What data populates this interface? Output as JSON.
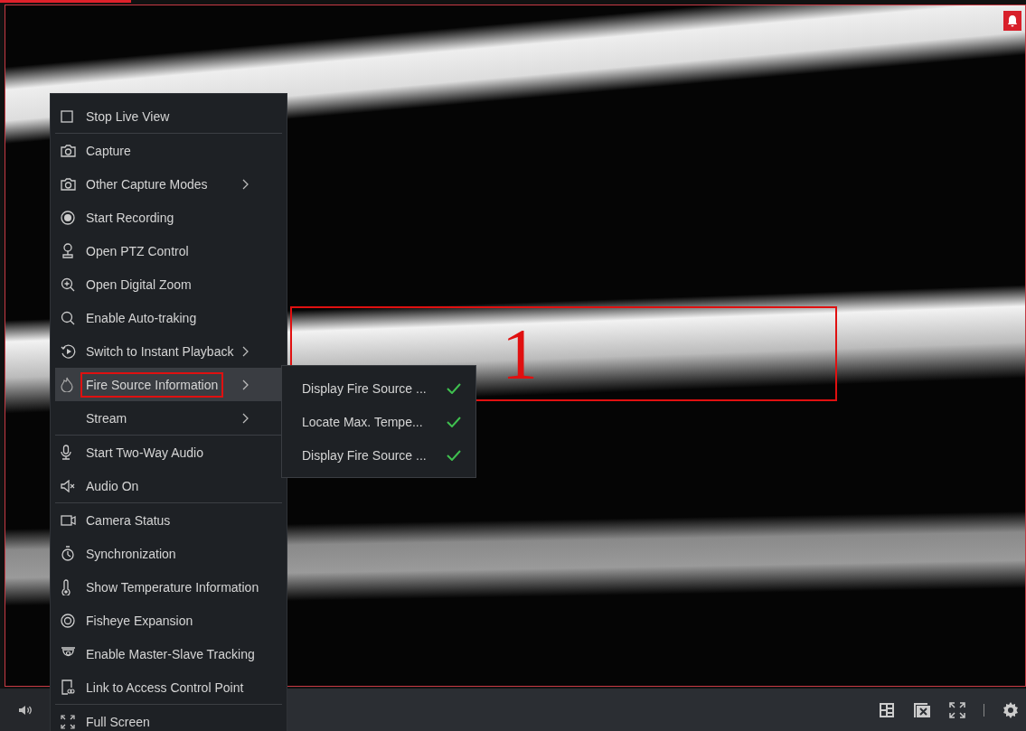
{
  "context_menu": {
    "groups": [
      [
        {
          "label": "Stop Live View",
          "submenu": false,
          "selected": false,
          "highlighted": false
        }
      ],
      [
        {
          "label": "Capture",
          "submenu": false,
          "selected": false,
          "highlighted": false
        },
        {
          "label": "Other Capture Modes",
          "submenu": true,
          "selected": false,
          "highlighted": false
        },
        {
          "label": "Start Recording",
          "submenu": false,
          "selected": false,
          "highlighted": false
        },
        {
          "label": "Open PTZ Control",
          "submenu": false,
          "selected": false,
          "highlighted": false
        },
        {
          "label": "Open Digital Zoom",
          "submenu": false,
          "selected": false,
          "highlighted": false
        },
        {
          "label": "Enable Auto-traking",
          "submenu": false,
          "selected": false,
          "highlighted": false
        },
        {
          "label": "Switch to Instant Playback",
          "submenu": true,
          "selected": false,
          "highlighted": false
        },
        {
          "label": "Fire Source Information",
          "submenu": true,
          "selected": true,
          "highlighted": true
        },
        {
          "label": "Stream",
          "submenu": true,
          "selected": false,
          "highlighted": false
        }
      ],
      [
        {
          "label": "Start Two-Way Audio",
          "submenu": false,
          "selected": false,
          "highlighted": false
        },
        {
          "label": "Audio On",
          "submenu": false,
          "selected": false,
          "highlighted": false
        }
      ],
      [
        {
          "label": "Camera Status",
          "submenu": false,
          "selected": false,
          "highlighted": false
        },
        {
          "label": "Synchronization",
          "submenu": false,
          "selected": false,
          "highlighted": false
        },
        {
          "label": "Show Temperature Information",
          "submenu": false,
          "selected": false,
          "highlighted": false
        },
        {
          "label": "Fisheye Expansion",
          "submenu": false,
          "selected": false,
          "highlighted": false
        },
        {
          "label": "Enable Master-Slave Tracking",
          "submenu": false,
          "selected": false,
          "highlighted": false
        },
        {
          "label": "Link to Access Control Point",
          "submenu": false,
          "selected": false,
          "highlighted": false
        }
      ],
      [
        {
          "label": "Full Screen",
          "submenu": false,
          "selected": false,
          "highlighted": false
        }
      ]
    ]
  },
  "submenu": {
    "items": [
      {
        "label": "Display Fire Source ...",
        "checked": true
      },
      {
        "label": "Locate Max. Tempe...",
        "checked": true
      },
      {
        "label": "Display Fire Source ...",
        "checked": true
      }
    ]
  },
  "annotations": [
    {
      "label": "1"
    }
  ]
}
